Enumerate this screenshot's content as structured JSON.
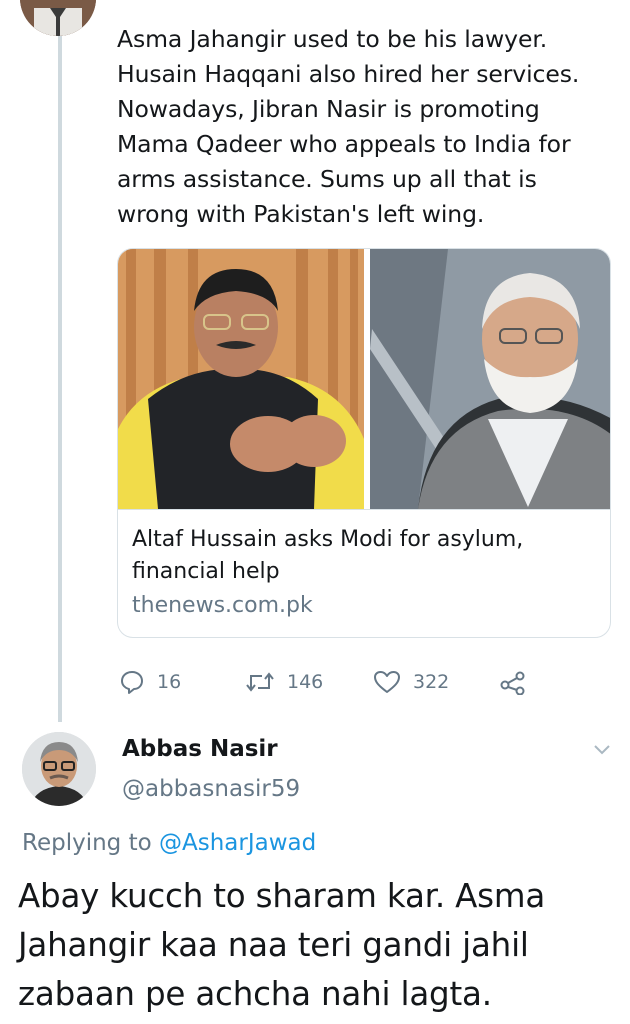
{
  "tweet1": {
    "text_lines": [
      "Asma Jahangir used to be his lawyer.",
      "Husain Haqqani also hired her services.",
      "Nowadays, Jibran Nasir is promoting",
      "Mama Qadeer who appeals to India for",
      "arms assistance. Sums up all that is",
      "wrong with Pakistan's left wing."
    ],
    "card": {
      "title_lines": [
        "Altaf Hussain asks Modi for asylum,",
        "financial help"
      ],
      "domain": "thenews.com.pk"
    },
    "actions": {
      "reply": {
        "icon": "reply-icon",
        "count": "16"
      },
      "retweet": {
        "icon": "retweet-icon",
        "count": "146"
      },
      "like": {
        "icon": "heart-icon",
        "count": "322"
      },
      "share": {
        "icon": "share-icon"
      }
    }
  },
  "tweet2": {
    "name": "Abbas Nasir",
    "handle": "@abbasnasir59",
    "replying_prefix": "Replying to",
    "replying_to": "@AsharJawad",
    "text_lines": [
      "Abay kucch to sharam kar. Asma",
      "Jahangir kaa naa teri gandi jahil",
      "zabaan pe achcha nahi lagta."
    ]
  },
  "colors": {
    "text": "#14171a",
    "secondary": "#657786",
    "link": "#1b95e0",
    "border": "#d9e1e6",
    "thread_line": "#cfd9de"
  }
}
